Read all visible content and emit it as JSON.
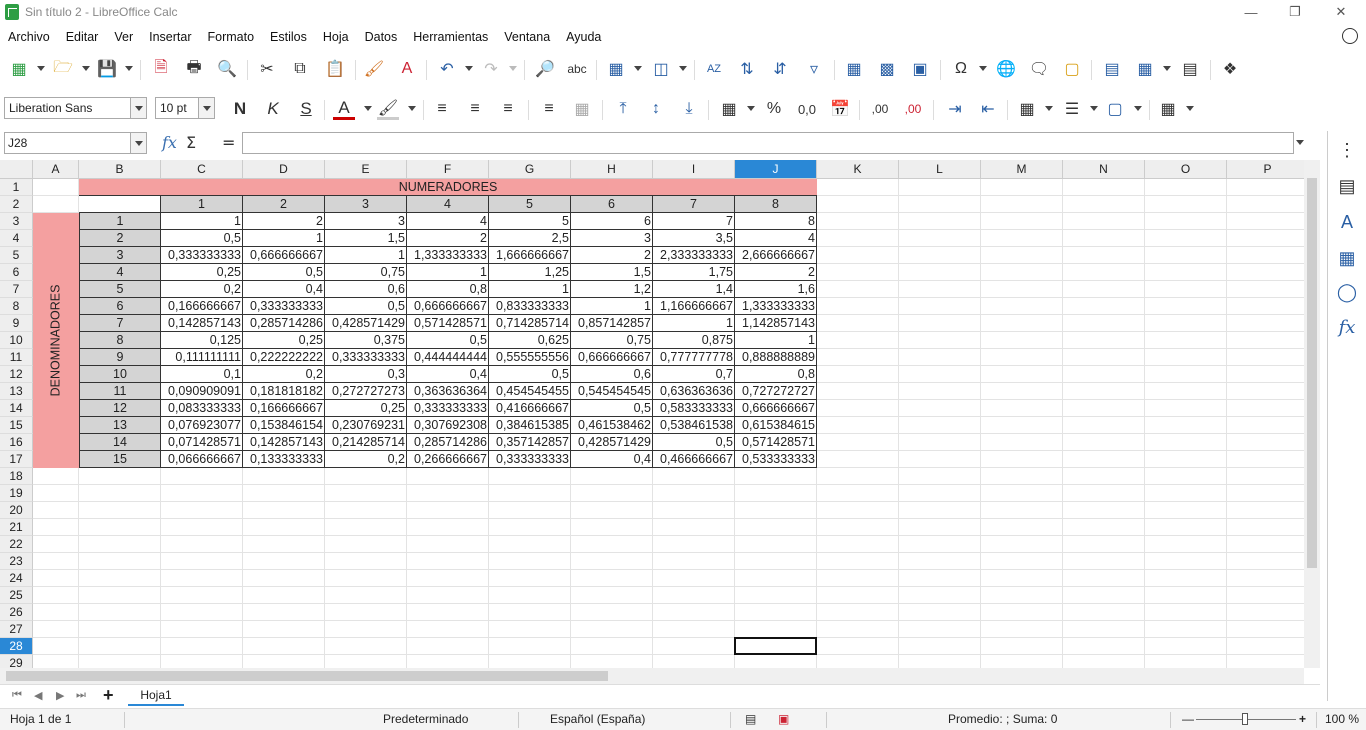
{
  "window": {
    "title": "Sin título 2 - LibreOffice Calc"
  },
  "menu": [
    "Archivo",
    "Editar",
    "Ver",
    "Insertar",
    "Formato",
    "Estilos",
    "Hoja",
    "Datos",
    "Herramientas",
    "Ventana",
    "Ayuda"
  ],
  "format_bar": {
    "font_name": "Liberation Sans",
    "font_size": "10 pt",
    "bold": "N",
    "italic": "K",
    "underline": "S"
  },
  "formula_bar": {
    "cell_ref": "J28",
    "fx": "fx",
    "sum": "Σ",
    "equals": "=",
    "content": ""
  },
  "columns": [
    "A",
    "B",
    "C",
    "D",
    "E",
    "F",
    "G",
    "H",
    "I",
    "J",
    "K",
    "L",
    "M",
    "N",
    "O",
    "P"
  ],
  "selected_column": "J",
  "rows": [
    "1",
    "2",
    "3",
    "4",
    "5",
    "6",
    "7",
    "8",
    "9",
    "10",
    "11",
    "12",
    "13",
    "14",
    "15",
    "16",
    "17",
    "18",
    "19",
    "20",
    "21",
    "22",
    "23",
    "24",
    "25",
    "26",
    "27",
    "28",
    "29"
  ],
  "selected_row": "28",
  "table": {
    "header_title": "NUMERADORES",
    "side_title": "DENOMINADORES",
    "numerators": [
      "1",
      "2",
      "3",
      "4",
      "5",
      "6",
      "7",
      "8"
    ],
    "denominators": [
      "1",
      "2",
      "3",
      "4",
      "5",
      "6",
      "7",
      "8",
      "9",
      "10",
      "11",
      "12",
      "13",
      "14",
      "15"
    ],
    "values": [
      [
        "1",
        "2",
        "3",
        "4",
        "5",
        "6",
        "7",
        "8"
      ],
      [
        "0,5",
        "1",
        "1,5",
        "2",
        "2,5",
        "3",
        "3,5",
        "4"
      ],
      [
        "0,333333333",
        "0,666666667",
        "1",
        "1,333333333",
        "1,666666667",
        "2",
        "2,333333333",
        "2,666666667"
      ],
      [
        "0,25",
        "0,5",
        "0,75",
        "1",
        "1,25",
        "1,5",
        "1,75",
        "2"
      ],
      [
        "0,2",
        "0,4",
        "0,6",
        "0,8",
        "1",
        "1,2",
        "1,4",
        "1,6"
      ],
      [
        "0,166666667",
        "0,333333333",
        "0,5",
        "0,666666667",
        "0,833333333",
        "1",
        "1,166666667",
        "1,333333333"
      ],
      [
        "0,142857143",
        "0,285714286",
        "0,428571429",
        "0,571428571",
        "0,714285714",
        "0,857142857",
        "1",
        "1,142857143"
      ],
      [
        "0,125",
        "0,25",
        "0,375",
        "0,5",
        "0,625",
        "0,75",
        "0,875",
        "1"
      ],
      [
        "0,111111111",
        "0,222222222",
        "0,333333333",
        "0,444444444",
        "0,555555556",
        "0,666666667",
        "0,777777778",
        "0,888888889"
      ],
      [
        "0,1",
        "0,2",
        "0,3",
        "0,4",
        "0,5",
        "0,6",
        "0,7",
        "0,8"
      ],
      [
        "0,090909091",
        "0,181818182",
        "0,272727273",
        "0,363636364",
        "0,454545455",
        "0,545454545",
        "0,636363636",
        "0,727272727"
      ],
      [
        "0,083333333",
        "0,166666667",
        "0,25",
        "0,333333333",
        "0,416666667",
        "0,5",
        "0,583333333",
        "0,666666667"
      ],
      [
        "0,076923077",
        "0,153846154",
        "0,230769231",
        "0,307692308",
        "0,384615385",
        "0,461538462",
        "0,538461538",
        "0,615384615"
      ],
      [
        "0,071428571",
        "0,142857143",
        "0,214285714",
        "0,285714286",
        "0,357142857",
        "0,428571429",
        "0,5",
        "0,571428571"
      ],
      [
        "0,066666667",
        "0,133333333",
        "0,2",
        "0,266666667",
        "0,333333333",
        "0,4",
        "0,466666667",
        "0,533333333"
      ]
    ]
  },
  "colors": {
    "header_fill": "#f4a0a0",
    "label_fill": "#d4d4d4",
    "selection": "#2a88d6"
  },
  "sheet_tabs": [
    "Hoja1"
  ],
  "status": {
    "sheet": "Hoja 1 de 1",
    "style": "Predeterminado",
    "language": "Español (España)",
    "summary": "Promedio: ; Suma: 0",
    "zoom": "100 %"
  }
}
